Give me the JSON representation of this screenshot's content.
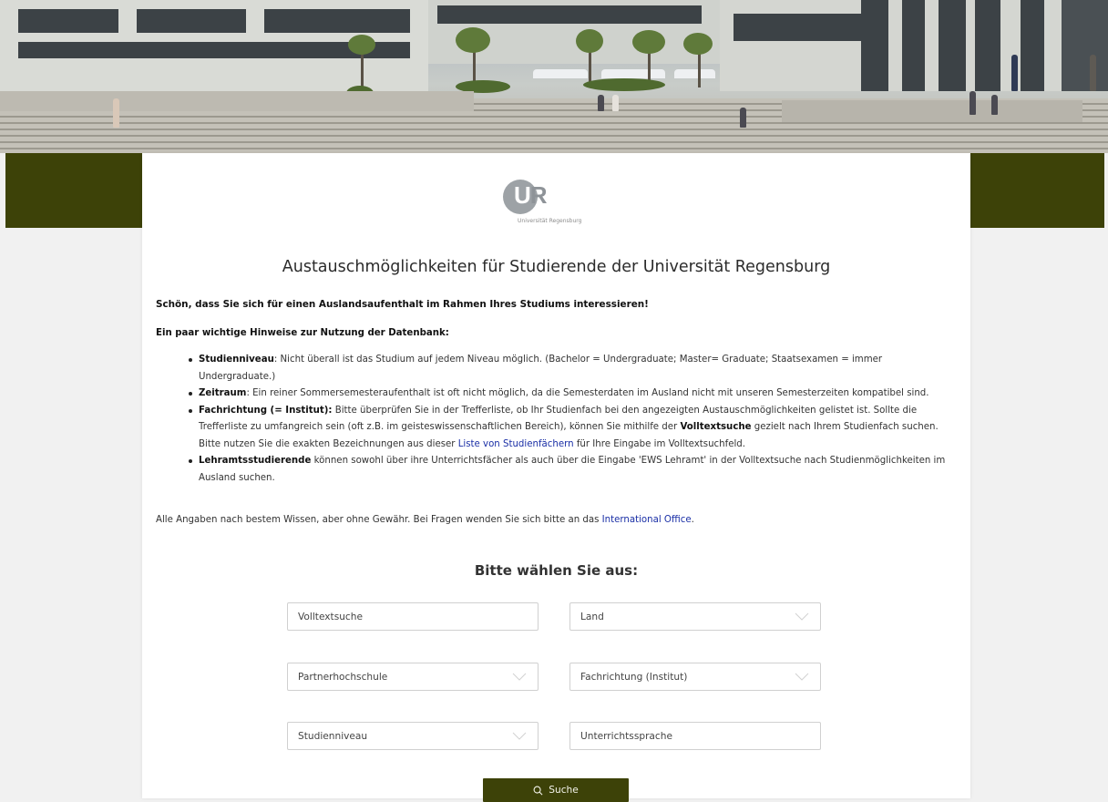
{
  "logo": {
    "letters_u": "U",
    "letters_r": "R",
    "subtitle": "Universität Regensburg"
  },
  "page": {
    "title": "Austauschmöglichkeiten für Studierende der Universität Regensburg",
    "intro": "Schön, dass Sie sich für einen Auslandsaufenthalt im Rahmen Ihres Studiums interessieren!",
    "notes_title": "Ein paar wichtige Hinweise zur Nutzung der Datenbank:"
  },
  "notes": {
    "studienniveau": {
      "term": "Studienniveau",
      "text": ": Nicht überall ist das Studium auf jedem Niveau möglich. (Bachelor = Undergraduate; Master= Graduate; Staatsexamen = immer Undergraduate.)"
    },
    "zeitraum": {
      "term": "Zeitraum",
      "text": ": Ein reiner Sommersemesteraufenthalt ist oft nicht möglich, da die Semesterdaten im Ausland nicht mit unseren Semesterzeiten kompatibel sind."
    },
    "fachrichtung": {
      "term": "Fachrichtung (= Institut):",
      "text1": " Bitte überprüfen Sie in der Trefferliste, ob Ihr Studienfach bei den angezeigten Austauschmöglichkeiten gelistet ist. Sollte die Trefferliste zu umfangreich sein (oft z.B. im geisteswissenschaftlichen Bereich), können Sie mithilfe der ",
      "term2": "Volltextsuche",
      "text2": " gezielt nach Ihrem Studienfach suchen. Bitte nutzen Sie die exakten Bezeichnungen aus dieser ",
      "link": "Liste von Studienfächern",
      "text3": " für Ihre Eingabe im Volltextsuchfeld."
    },
    "lehramt": {
      "term": "Lehramtsstudierende",
      "text": " können sowohl über ihre Unterrichtsfächer als auch über die Eingabe 'EWS Lehramt' in der Volltextsuche nach Studienmöglichkeiten im Ausland suchen."
    }
  },
  "disclaimer": {
    "text": "Alle Angaben nach bestem Wissen, aber ohne Gewähr. Bei Fragen wenden Sie sich bitte an das ",
    "link": "International Office",
    "end": "."
  },
  "filters": {
    "heading": "Bitte wählen Sie aus:",
    "fulltext_placeholder": "Volltextsuche",
    "land": "Land",
    "partner": "Partnerhochschule",
    "fachrichtung": "Fachrichtung (Institut)",
    "studienniveau": "Studienniveau",
    "sprache_placeholder": "Unterrichtssprache"
  },
  "search_button": {
    "label": "Suche",
    "icon": "search-icon"
  },
  "colors": {
    "brand_olive": "#3d4208",
    "link_blue": "#1a2fa6",
    "page_bg": "#f1f1f1"
  }
}
